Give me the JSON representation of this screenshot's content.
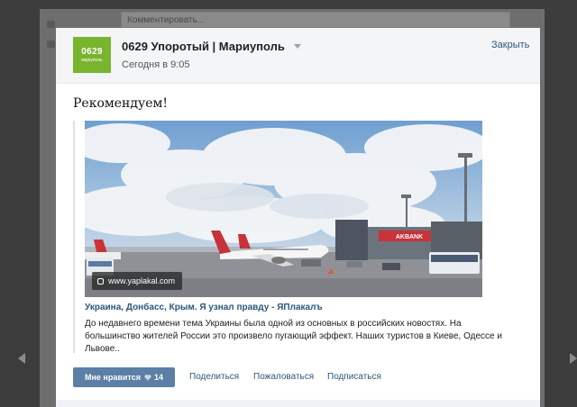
{
  "background": {
    "comment_placeholder": "Комментировать..."
  },
  "header": {
    "logo_main": "0629",
    "logo_sub": "маріуполь",
    "group_name": "0629 Упоротый | Мариуполь",
    "date": "Сегодня в 9:05",
    "close_label": "Закрыть"
  },
  "post": {
    "text": "Рекомендуем!",
    "attachment": {
      "source_badge": "www.yaplakal.com",
      "title": "Украина, Донбасс, Крым. Я узнал правду - ЯПлакалъ",
      "description": "До недавнего времени тема Украины была одной из основных в российских новостях. На большинство жителей России это произвело пугающий эффект. Наших туристов в Киеве, Одессе и Львове..",
      "photo_text": "AKBANK"
    }
  },
  "actions": {
    "like_label": "Мне нравится",
    "like_count": "14",
    "share_label": "Поделиться",
    "report_label": "Пожаловаться",
    "subscribe_label": "Подписаться"
  },
  "colors": {
    "link": "#2b587a",
    "button": "#5b7fa6",
    "logo": "#78b42d"
  },
  "icons": {
    "heart": "heart-icon",
    "link": "link-icon",
    "dropdown": "chevron-down-icon"
  }
}
